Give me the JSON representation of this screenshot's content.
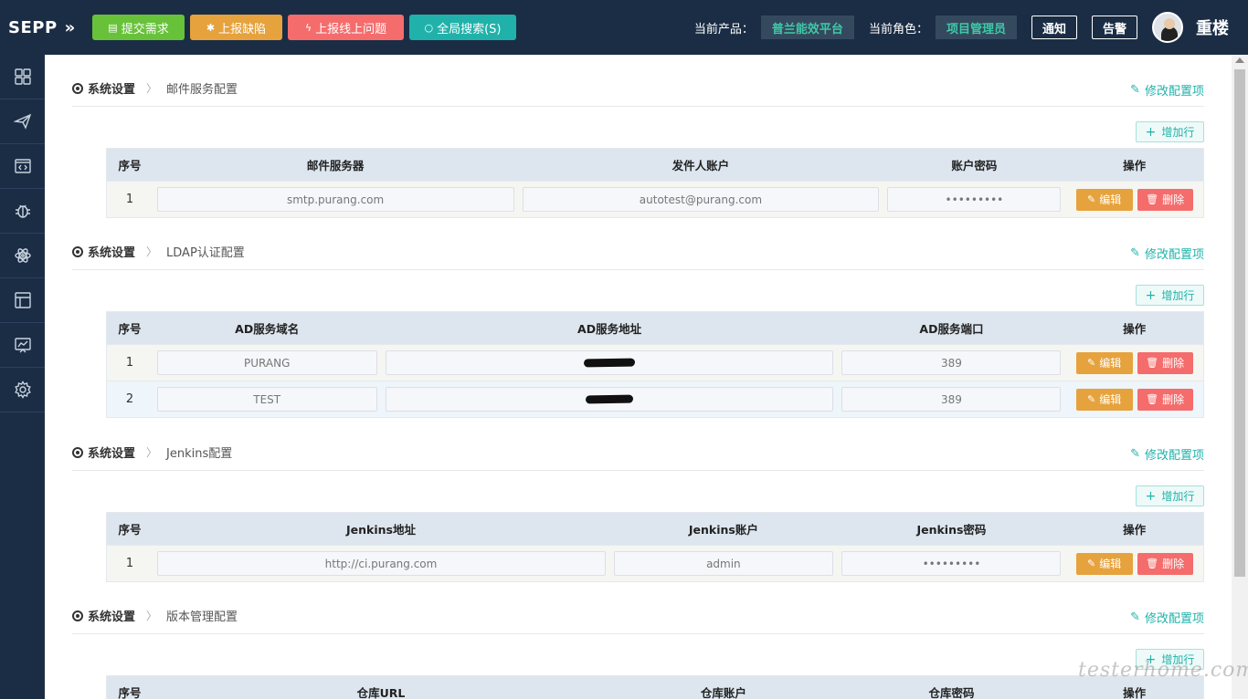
{
  "app": {
    "logo": "SEPP",
    "buttons": {
      "submit_req": "提交需求",
      "report_bug": "上报缺陷",
      "report_online": "上报线上问题",
      "global_search": "全局搜索(S)"
    },
    "product_label": "当前产品：",
    "product_value": "普兰能效平台",
    "role_label": "当前角色：",
    "role_value": "项目管理员",
    "notify": "通知",
    "alarm": "告警",
    "username": "重楼"
  },
  "common": {
    "crumb_root": "系统设置",
    "edit_config": "修改配置项",
    "add_row": "增加行",
    "edit": "编辑",
    "delete": "删除",
    "seq": "序号",
    "ops": "操作"
  },
  "mail": {
    "title": "邮件服务配置",
    "cols": [
      "邮件服务器",
      "发件人账户",
      "账户密码"
    ],
    "rows": [
      {
        "no": "1",
        "server": "smtp.purang.com",
        "account": "autotest@purang.com",
        "password": "•••••••••"
      }
    ]
  },
  "ldap": {
    "title": "LDAP认证配置",
    "cols": [
      "AD服务域名",
      "AD服务地址",
      "AD服务端口"
    ],
    "rows": [
      {
        "no": "1",
        "domain": "PURANG",
        "port": "389"
      },
      {
        "no": "2",
        "domain": "TEST",
        "port": "389"
      }
    ]
  },
  "jenkins": {
    "title": "Jenkins配置",
    "cols": [
      "Jenkins地址",
      "Jenkins账户",
      "Jenkins密码"
    ],
    "rows": [
      {
        "no": "1",
        "url": "http://ci.purang.com",
        "account": "admin",
        "password": "•••••••••"
      }
    ]
  },
  "version": {
    "title": "版本管理配置",
    "cols": [
      "仓库URL",
      "仓库账户",
      "仓库密码"
    ]
  },
  "watermark": "testerhome.com"
}
